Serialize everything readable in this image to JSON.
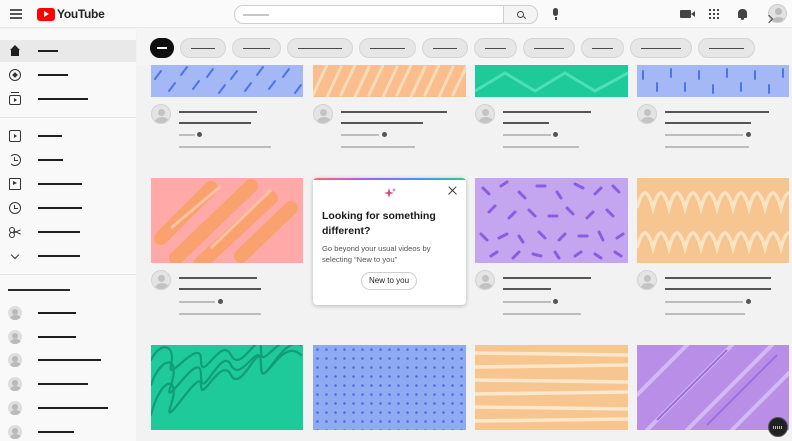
{
  "header": {
    "logo_text": "YouTube",
    "brand_color": "#ff0000",
    "search_icon": "search-icon",
    "mic_icon": "mic-icon",
    "create_icon": "video-camera-icon",
    "apps_icon": "apps-grid-icon",
    "notifications_icon": "bell-icon"
  },
  "sidebar": {
    "primary_icons": [
      "home-icon",
      "compass-icon",
      "subscriptions-icon"
    ],
    "secondary_icons": [
      "library-icon",
      "history-icon",
      "your-videos-icon",
      "watch-later-icon",
      "clips-icon",
      "chevron-down-icon"
    ]
  },
  "chips": {
    "count": 11,
    "selected_index": 0
  },
  "popup": {
    "title": "Looking for something different?",
    "description": "Go beyond your usual videos by selecting “New to you”",
    "button_label": "New to you",
    "icon": "sparkle-icon",
    "close_icon": "close-icon",
    "gradient_colors": [
      "#ff6b6b",
      "#a95fe6",
      "#4c8dff",
      "#35c58f"
    ]
  },
  "thumb_colors": {
    "blue": "#a3b8f5",
    "orange": "#f9bd8e",
    "teal": "#1ec99a",
    "pink": "#ffaaa8",
    "lavender": "#c4a6f0",
    "peach": "#f7c590",
    "purple": "#b88ee7"
  }
}
